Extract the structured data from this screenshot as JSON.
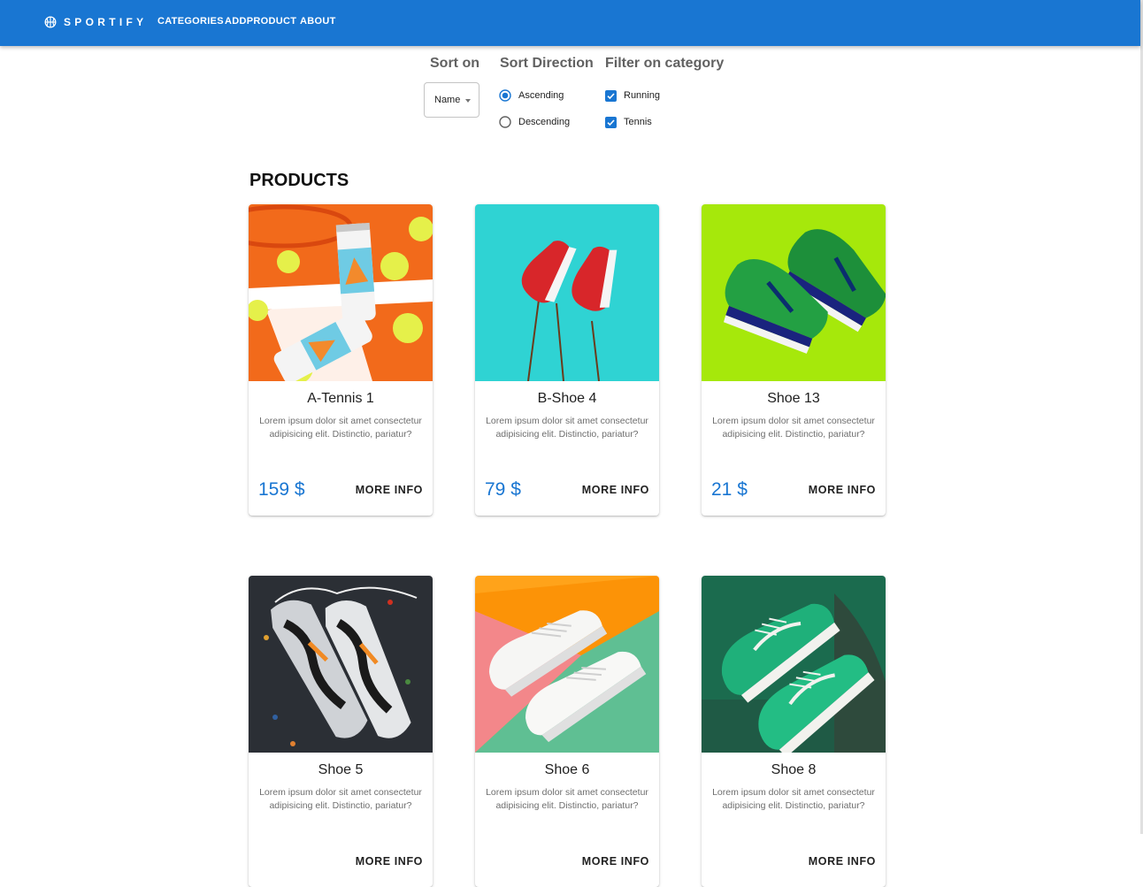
{
  "brand": {
    "name": "SPORTIFY",
    "icon": "basketball-icon",
    "color": "#1976d2"
  },
  "nav": {
    "categories": "CATEGORIES",
    "addproduct": "ADDPRODUCT",
    "about": "ABOUT"
  },
  "filters": {
    "sort_on": {
      "label": "Sort on",
      "value": "Name"
    },
    "sort_direction": {
      "label": "Sort Direction",
      "options": [
        {
          "label": "Ascending",
          "selected": true
        },
        {
          "label": "Descending",
          "selected": false
        }
      ]
    },
    "category": {
      "label": "Filter on category",
      "options": [
        {
          "label": "Running",
          "checked": true
        },
        {
          "label": "Tennis",
          "checked": true
        }
      ]
    }
  },
  "products": {
    "heading": "PRODUCTS",
    "more_info_label": "MORE INFO",
    "items": [
      {
        "name": "A-Tennis 1",
        "description": "Lorem ipsum dolor sit amet consectetur adipisicing elit. Distinctio, pariatur?",
        "price": "159 $",
        "image": "tennis-balls-and-drink-cans"
      },
      {
        "name": "B-Shoe 4",
        "description": "Lorem ipsum dolor sit amet consectetur adipisicing elit. Distinctio, pariatur?",
        "price": "79 $",
        "image": "red-sneakers-on-sticks"
      },
      {
        "name": "Shoe 13",
        "description": "Lorem ipsum dolor sit amet consectetur adipisicing elit. Distinctio, pariatur?",
        "price": "21 $",
        "image": "green-running-shoes"
      },
      {
        "name": "Shoe 5",
        "description": "Lorem ipsum dolor sit amet consectetur adipisicing elit. Distinctio, pariatur?",
        "price": "",
        "image": "grey-chunky-sneakers"
      },
      {
        "name": "Shoe 6",
        "description": "Lorem ipsum dolor sit amet consectetur adipisicing elit. Distinctio, pariatur?",
        "price": "",
        "image": "white-canvas-sneakers"
      },
      {
        "name": "Shoe 8",
        "description": "Lorem ipsum dolor sit amet consectetur adipisicing elit. Distinctio, pariatur?",
        "price": "",
        "image": "green-skate-shoes"
      }
    ]
  }
}
